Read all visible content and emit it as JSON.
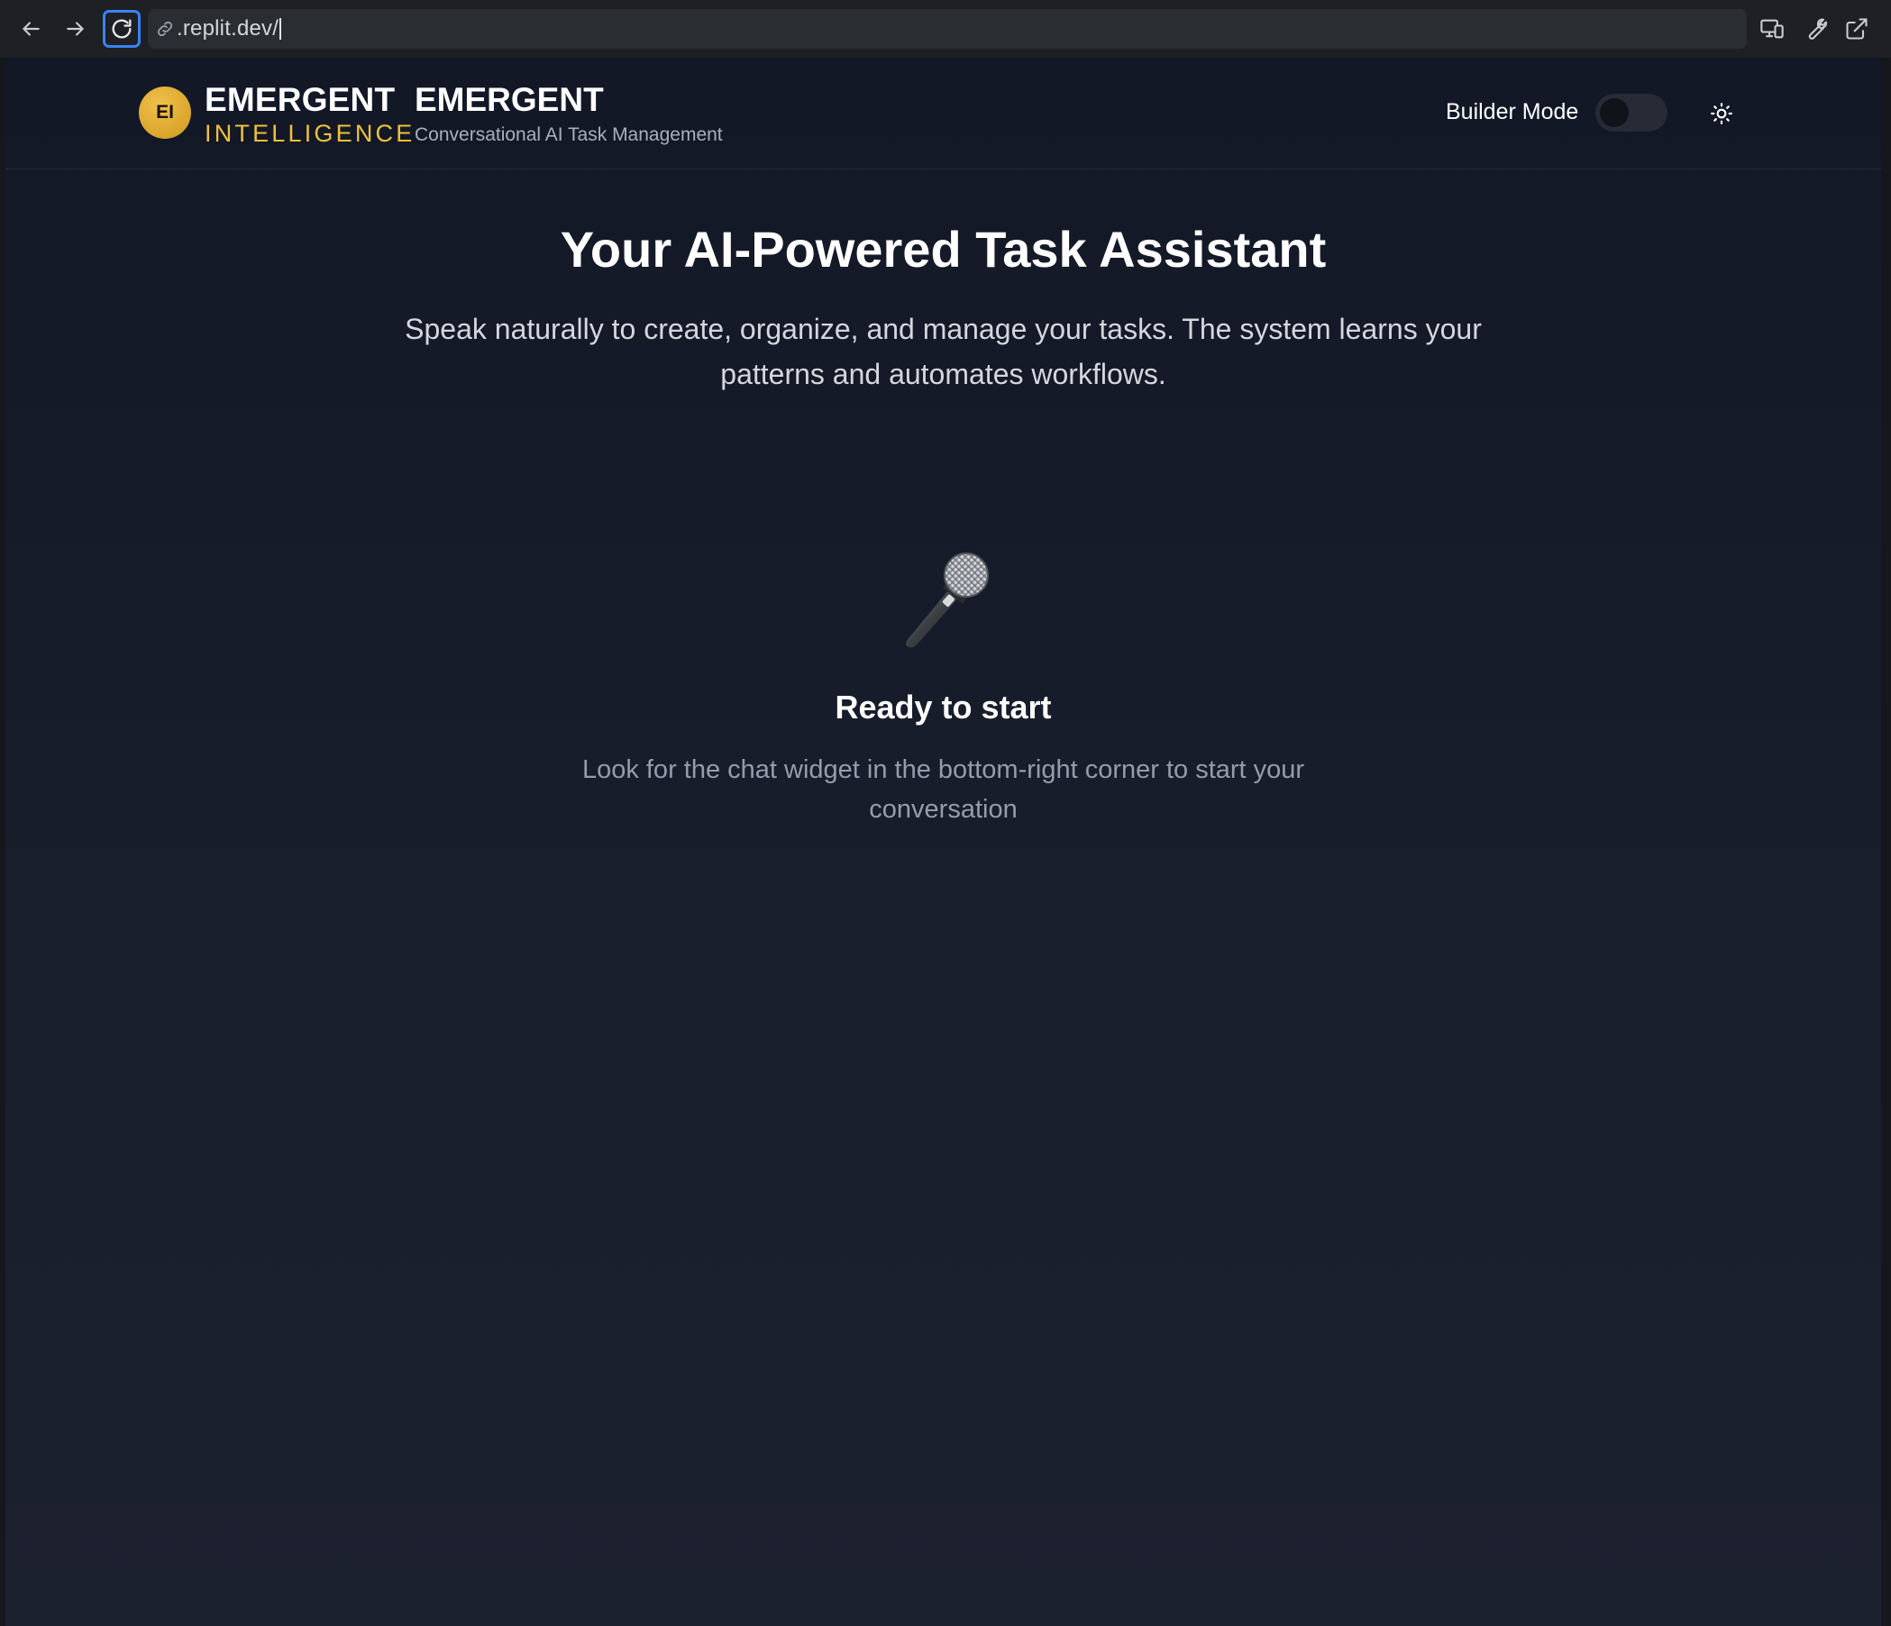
{
  "browser": {
    "url": ".replit.dev/",
    "icons": {
      "back": "arrow-left-icon",
      "forward": "arrow-right-icon",
      "reload": "reload-icon",
      "link": "link-icon",
      "devices": "devices-icon",
      "tools": "wrench-icon",
      "external": "external-link-icon"
    }
  },
  "header": {
    "logo_initials": "EI",
    "brand_line1": "EMERGENT",
    "brand_line2": "INTELLIGENCE",
    "product_title": "EMERGENT",
    "product_subtitle": "Conversational AI Task Management",
    "builder_mode_label": "Builder Mode",
    "builder_mode_on": false,
    "theme_icon": "sun-icon"
  },
  "hero": {
    "title": "Your AI-Powered Task Assistant",
    "description": "Speak naturally to create, organize, and manage your tasks. The system learns your patterns and automates workflows."
  },
  "empty_state": {
    "icon": "microphone-icon",
    "title": "Ready to start",
    "description": "Look for the chat widget in the bottom-right corner to start your conversation"
  },
  "colors": {
    "accent_gold": "#f0c03a",
    "focus_blue": "#3b82f6",
    "background": "#171d2a"
  }
}
